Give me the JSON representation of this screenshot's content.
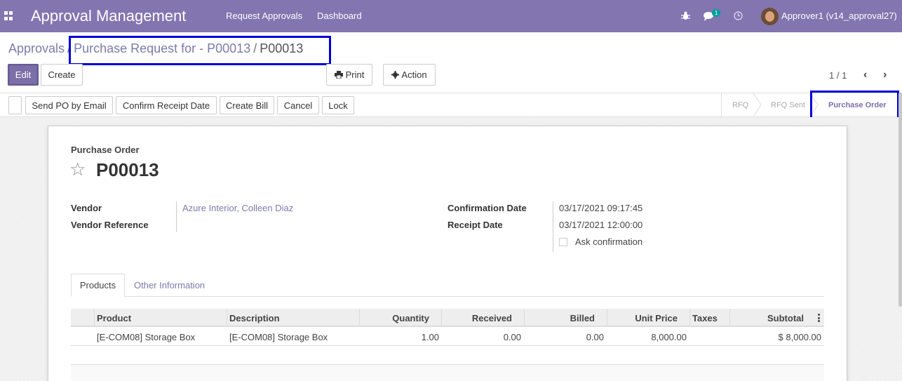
{
  "navbar": {
    "app_title": "Approval Management",
    "menu": [
      "Request Approvals",
      "Dashboard"
    ],
    "chat_count": "1",
    "user": "Approver1 (v14_approval27)",
    "icons": [
      "apps-icon",
      "bug-icon",
      "chat-icon",
      "clock-icon"
    ]
  },
  "breadcrumb": {
    "root": "Approvals",
    "separator": "/",
    "parent": "Purchase Request for - P00013",
    "current": "P00013"
  },
  "control": {
    "edit": "Edit",
    "create": "Create",
    "print": "Print",
    "action": "Action",
    "pager": "1 / 1"
  },
  "statusbar": {
    "buttons": [
      "Send PO by Email",
      "Confirm Receipt Date",
      "Create Bill",
      "Cancel",
      "Lock"
    ],
    "stages": [
      "RFQ",
      "RFQ Sent",
      "Purchase Order"
    ],
    "current_stage": "Purchase Order"
  },
  "form": {
    "kind": "Purchase Order",
    "name": "P00013",
    "left": [
      {
        "label": "Vendor",
        "value": "Azure Interior, Colleen Diaz"
      },
      {
        "label": "Vendor Reference",
        "value": ""
      }
    ],
    "right": [
      {
        "label": "Confirmation Date",
        "value": "03/17/2021 09:17:45"
      },
      {
        "label": "Receipt Date",
        "value": "03/17/2021 12:00:00"
      }
    ],
    "ask_confirmation": {
      "label": "Ask confirmation",
      "checked": false
    }
  },
  "tabs": [
    "Products",
    "Other Information"
  ],
  "table": {
    "columns": [
      "Product",
      "Description",
      "Quantity",
      "Received",
      "Billed",
      "Unit Price",
      "Taxes",
      "Subtotal"
    ],
    "rows": [
      [
        "[E-COM08] Storage Box",
        "[E-COM08] Storage Box",
        "1.00",
        "0.00",
        "0.00",
        "8,000.00",
        "",
        "$ 8,000.00"
      ]
    ]
  },
  "colors": {
    "brand": "#8275b0",
    "highlight": "#0000d6",
    "link": "#7c7bad"
  }
}
